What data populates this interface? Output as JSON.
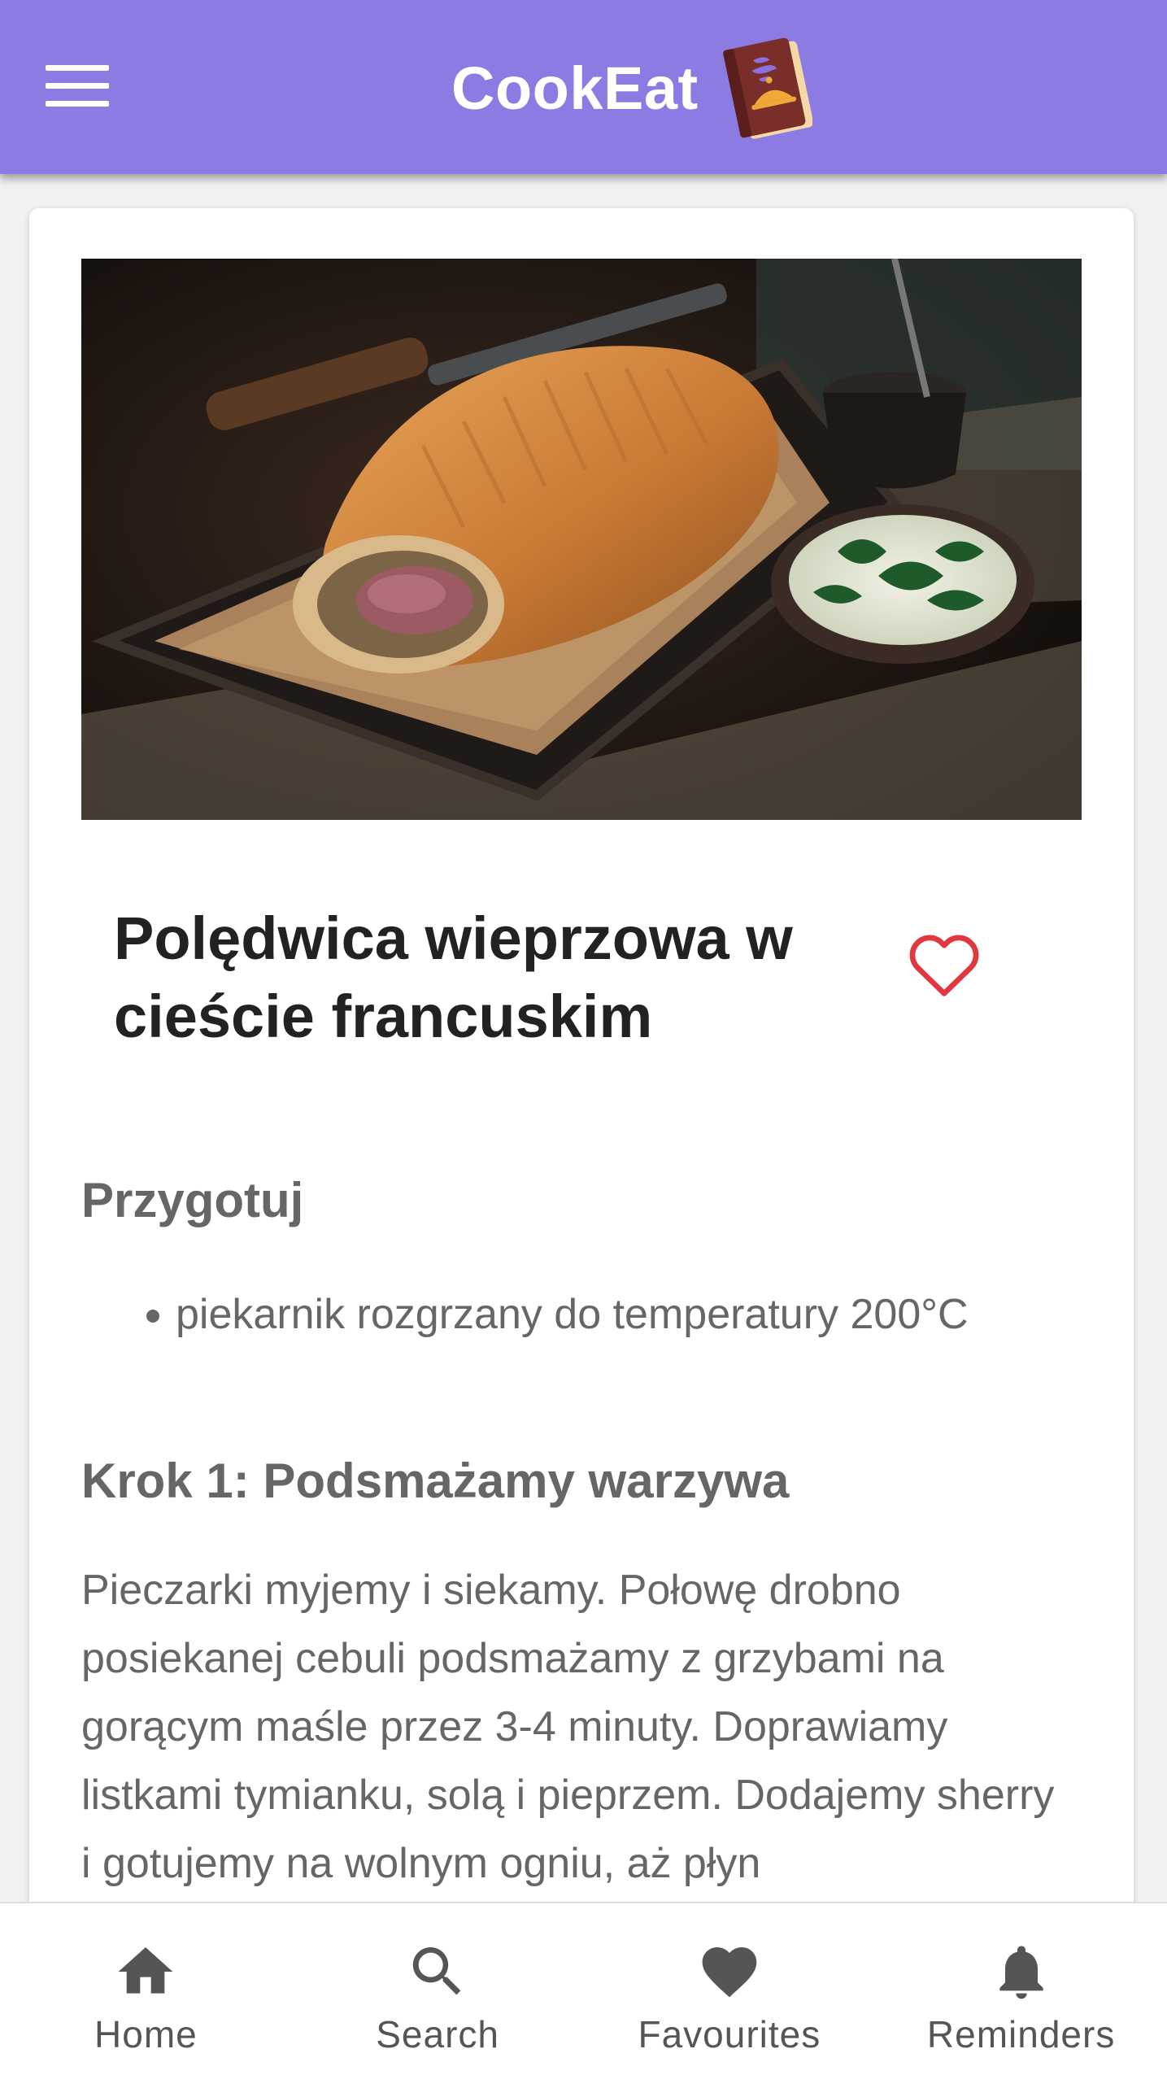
{
  "app": {
    "title": "CookEat",
    "brand_color": "#8c7be2"
  },
  "recipe": {
    "title": "Polędwica wieprzowa w cieście francuskim",
    "favourite": false,
    "favourite_icon_color": "#e0383e",
    "prepare_heading": "Przygotuj",
    "prepare_items": [
      "piekarnik rozgrzany do temperatury 200°C"
    ],
    "steps": [
      {
        "heading": "Krok 1: Podsmażamy warzywa",
        "text": "Pieczarki myjemy i siekamy. Połowę drobno posiekanej cebuli podsmażamy z grzybami na gorącym maśle przez 3-4 minuty. Doprawiamy listkami tymianku, solą i pieprzem. Dodajemy sherry i gotujemy na wolnym ogniu, aż płyn"
      }
    ]
  },
  "bottom_nav": {
    "items": [
      {
        "label": "Home",
        "icon": "home-icon"
      },
      {
        "label": "Search",
        "icon": "search-icon"
      },
      {
        "label": "Favourites",
        "icon": "heart-icon"
      },
      {
        "label": "Reminders",
        "icon": "bell-icon"
      }
    ]
  }
}
